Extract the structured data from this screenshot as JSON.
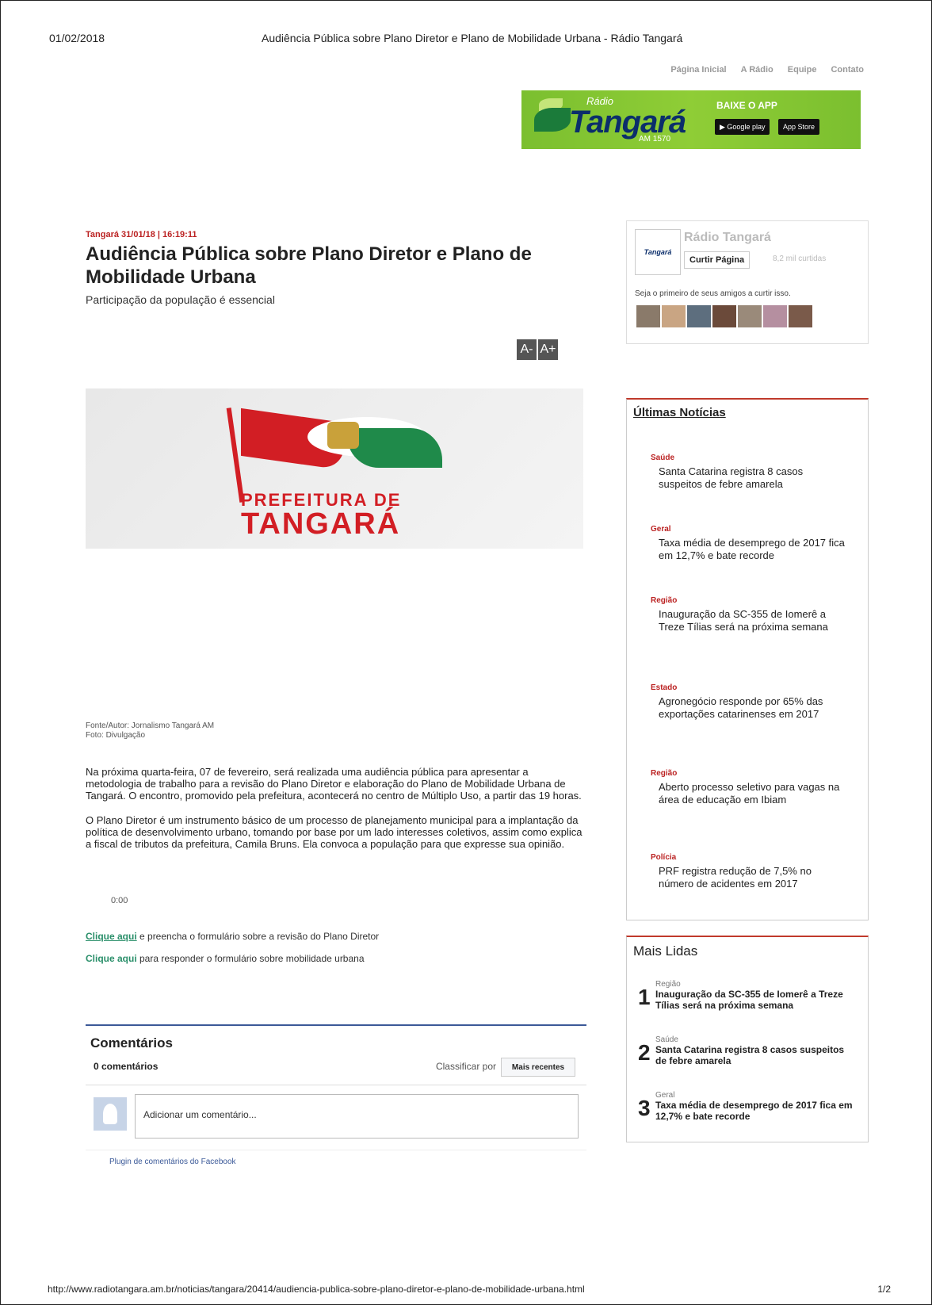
{
  "print_header": {
    "date": "01/02/2018",
    "title": "Audiência Pública sobre Plano Diretor e Plano de Mobilidade Urbana - Rádio Tangará"
  },
  "print_footer": {
    "url": "http://www.radiotangara.am.br/noticias/tangara/20414/audiencia-publica-sobre-plano-diretor-e-plano-de-mobilidade-urbana.html",
    "page": "1/2"
  },
  "topnav": [
    "Página Inicial",
    "A Rádio",
    "Equipe",
    "Contato"
  ],
  "banner": {
    "radio": "Rádio",
    "brand": "Tangará",
    "am": "AM 1570",
    "baixe": "BAIXE O APP",
    "google_play": "▶ Google play",
    "app_store": " App Store"
  },
  "article": {
    "kicker": "Tangará 31/01/18 | 16:19:11",
    "title": "Audiência Pública sobre Plano Diretor e Plano de Mobilidade Urbana",
    "subtitle": "Participação da população é essencial",
    "font_minus": "A-",
    "font_plus": "A+",
    "hero_line1": "PREFEITURA DE",
    "hero_line2": "TANGARÁ",
    "credit_author": "Fonte/Autor: Jornalismo Tangará AM",
    "credit_photo": "Foto: Divulgação",
    "paragraph1": "Na próxima quarta-feira, 07 de fevereiro, será realizada uma audiência pública para apresentar a metodologia de trabalho para a revisão do Plano Diretor e elaboração do Plano de Mobilidade Urbana de Tangará. O encontro, promovido pela prefeitura, acontecerá no centro de Múltiplo Uso, a partir das 19 horas.",
    "paragraph2": "O Plano Diretor é um instrumento básico de um processo de planejamento municipal para a implantação da política de desenvolvimento urbano, tomando por base por um lado interesses coletivos, assim como explica a fiscal de tributos da prefeitura, Camila Bruns. Ela convoca a população para que expresse sua opinião.",
    "audio_time": "0:00",
    "link1_text": "Clique aqui",
    "link1_rest": " e preencha o formulário sobre a revisão do Plano Diretor",
    "link2_text": "Clique aqui",
    "link2_rest": "  para responder o formulário sobre mobilidade urbana"
  },
  "comments": {
    "title": "Comentários",
    "count": "0 comentários",
    "sort_label": "Classificar por",
    "sort_value": "Mais recentes",
    "placeholder": "Adicionar um comentário...",
    "plugin": "Plugin de comentários do Facebook"
  },
  "fb_widget": {
    "thumb_text": "Tangará",
    "name": "Rádio Tangará",
    "like_button": "Curtir Página",
    "likes": "8,2 mil curtidas",
    "friends_text": "Seja o primeiro de seus amigos a curtir isso."
  },
  "latest": {
    "title": "Últimas Notícias",
    "items": [
      {
        "category": "Saúde",
        "headline": "Santa Catarina registra 8 casos suspeitos de febre amarela"
      },
      {
        "category": "Geral",
        "headline": "Taxa média de desemprego de 2017 fica em 12,7% e bate recorde"
      },
      {
        "category": "Região",
        "headline": "Inauguração da SC-355 de Iomerê a Treze Tílias será na próxima semana"
      },
      {
        "category": "Estado",
        "headline": "Agronegócio responde por 65% das exportações catarinenses em 2017"
      },
      {
        "category": "Região",
        "headline": "Aberto processo seletivo para vagas na área de educação em Ibiam"
      },
      {
        "category": "Polícia",
        "headline": "PRF registra redução de 7,5% no número de acidentes em 2017"
      }
    ]
  },
  "most_read": {
    "title": "Mais Lidas",
    "items": [
      {
        "rank": "1",
        "category": "Região",
        "headline": "Inauguração da SC-355 de Iomerê a Treze Tílias será na próxima semana"
      },
      {
        "rank": "2",
        "category": "Saúde",
        "headline": "Santa Catarina registra 8 casos suspeitos de febre amarela"
      },
      {
        "rank": "3",
        "category": "Geral",
        "headline": "Taxa média de desemprego de 2017 fica em 12,7% e bate recorde"
      }
    ]
  }
}
